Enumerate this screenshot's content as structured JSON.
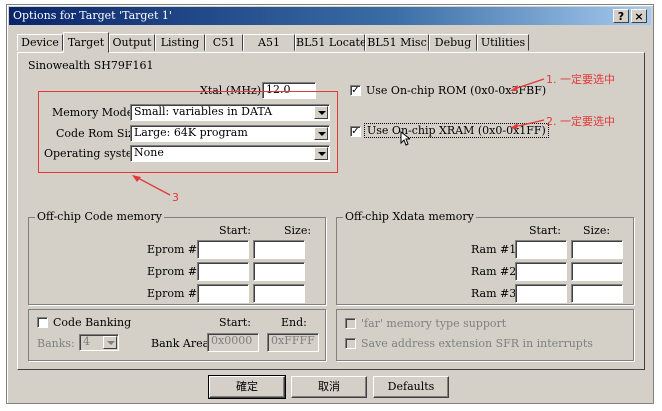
{
  "window": {
    "title": "Options for Target 'Target 1'",
    "help_label": "?",
    "close_label": "×"
  },
  "tabs": [
    {
      "label": "Device"
    },
    {
      "label": "Target"
    },
    {
      "label": "Output"
    },
    {
      "label": "Listing"
    },
    {
      "label": "C51"
    },
    {
      "label": "A51"
    },
    {
      "label": "BL51 Locate"
    },
    {
      "label": "BL51 Misc"
    },
    {
      "label": "Debug"
    },
    {
      "label": "Utilities"
    }
  ],
  "active_tab": "Target",
  "device_name": "Sinowealth SH79F161",
  "xtal": {
    "label": "Xtal (MHz):",
    "value": "12.0"
  },
  "memory_model": {
    "label": "Memory Model:",
    "value": "Small: variables in DATA"
  },
  "code_rom_size": {
    "label": "Code Rom Size:",
    "value": "Large: 64K program"
  },
  "operating_system": {
    "label": "Operating system:",
    "value": "None"
  },
  "onchip_rom": {
    "label": "Use On-chip ROM (0x0-0x3FBF)",
    "checked": true,
    "mark": "✓"
  },
  "onchip_xram": {
    "label": "Use On-chip XRAM (0x0-0x1FF)",
    "checked": true,
    "mark": "✓"
  },
  "annotations": {
    "note1": "1.  一定要选中",
    "note2": "2.  一定要选中",
    "note3": "3"
  },
  "code_memory": {
    "title": "Off-chip Code memory",
    "start_header": "Start:",
    "size_header": "Size:",
    "rows": [
      {
        "label": "Eprom #1:",
        "start": "",
        "size": ""
      },
      {
        "label": "Eprom #2:",
        "start": "",
        "size": ""
      },
      {
        "label": "Eprom #3:",
        "start": "",
        "size": ""
      }
    ]
  },
  "xdata_memory": {
    "title": "Off-chip Xdata memory",
    "start_header": "Start:",
    "size_header": "Size:",
    "rows": [
      {
        "label": "Ram #1:",
        "start": "",
        "size": ""
      },
      {
        "label": "Ram #2:",
        "start": "",
        "size": ""
      },
      {
        "label": "Ram #3:",
        "start": "",
        "size": ""
      }
    ]
  },
  "code_banking": {
    "label": "Code Banking",
    "checked": false,
    "banks_label": "Banks:",
    "banks_value": "4",
    "start_header": "Start:",
    "end_header": "End:",
    "bank_area_label": "Bank Area:",
    "bank_area_start": "0x0000",
    "bank_area_end": "0xFFFF"
  },
  "far_support": {
    "label": "'far' memory type support",
    "checked": false
  },
  "save_sfr": {
    "label": "Save address extension SFR in interrupts",
    "checked": false
  },
  "buttons": {
    "ok": "確定",
    "cancel": "取消",
    "defaults": "Defaults"
  },
  "colors": {
    "annotation": "#e23a3a",
    "titlebar": "#0a246a",
    "dialog": "#d4d0c8"
  }
}
